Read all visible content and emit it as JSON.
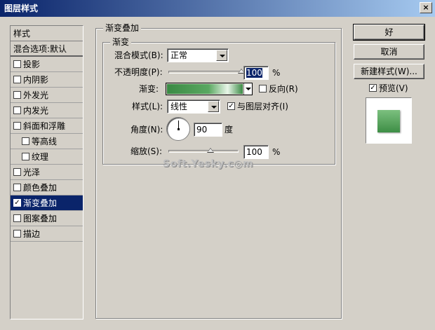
{
  "window": {
    "title": "图层样式",
    "close_glyph": "×"
  },
  "sidebar": {
    "header": "样式",
    "blend_options": "混合选项:默认",
    "items": [
      {
        "label": "投影",
        "checked": false,
        "indent": false
      },
      {
        "label": "内阴影",
        "checked": false,
        "indent": false
      },
      {
        "label": "外发光",
        "checked": false,
        "indent": false
      },
      {
        "label": "内发光",
        "checked": false,
        "indent": false
      },
      {
        "label": "斜面和浮雕",
        "checked": false,
        "indent": false
      },
      {
        "label": "等高线",
        "checked": false,
        "indent": true
      },
      {
        "label": "纹理",
        "checked": false,
        "indent": true
      },
      {
        "label": "光泽",
        "checked": false,
        "indent": false
      },
      {
        "label": "颜色叠加",
        "checked": false,
        "indent": false
      },
      {
        "label": "渐变叠加",
        "checked": true,
        "indent": false,
        "selected": true
      },
      {
        "label": "图案叠加",
        "checked": false,
        "indent": false
      },
      {
        "label": "描边",
        "checked": false,
        "indent": false
      }
    ]
  },
  "panel": {
    "group_title": "渐变叠加",
    "subgroup_title": "渐变",
    "blend_mode_label": "混合模式(B):",
    "blend_mode_value": "正常",
    "opacity_label": "不透明度(P):",
    "opacity_value": "100",
    "opacity_unit": "%",
    "opacity_fraction": 1.0,
    "gradient_label": "渐变:",
    "reverse_label": "反向(R)",
    "reverse_checked": false,
    "style_label": "样式(L):",
    "style_value": "线性",
    "align_label": "与图层对齐(I)",
    "align_checked": true,
    "angle_label": "角度(N):",
    "angle_value": "90",
    "angle_unit": "度",
    "scale_label": "缩放(S):",
    "scale_value": "100",
    "scale_unit": "%",
    "scale_fraction": 0.6
  },
  "buttons": {
    "ok": "好",
    "cancel": "取消",
    "new_style": "新建样式(W)...",
    "preview_label": "预览(V)",
    "preview_checked": true
  },
  "watermark": "Soft.Yesky.c◎m",
  "colors": {
    "title_start": "#0a246a",
    "title_end": "#a6caf0",
    "selection": "#0a246a",
    "gradient_green": "#3a8a44"
  }
}
